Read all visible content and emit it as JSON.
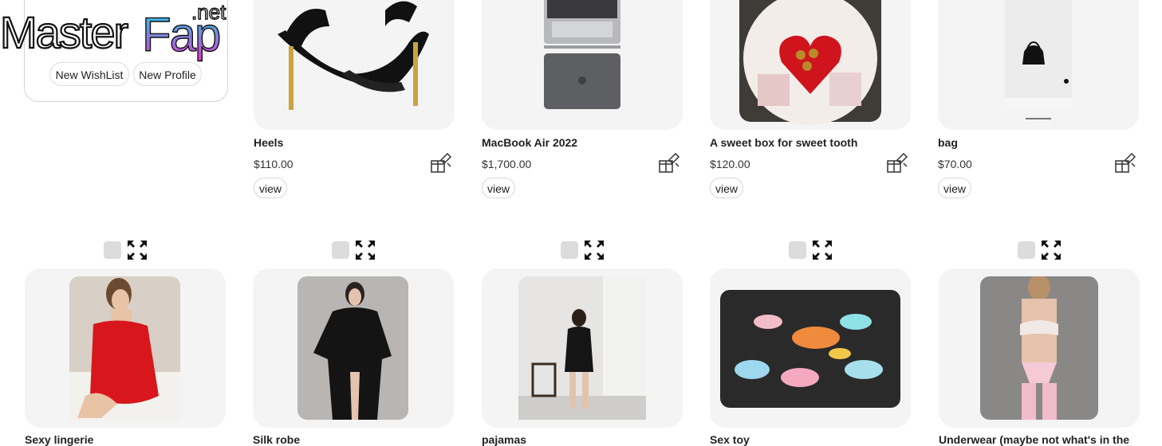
{
  "site": {
    "brand_main": "MasterFap",
    "brand_suffix": ".net"
  },
  "sidebar": {
    "new_wishlist_label": "New WishList",
    "new_profile_label": "New Profile"
  },
  "top_products": [
    {
      "name": "Heels",
      "price": "$110.00",
      "view_label": "view"
    },
    {
      "name": "MacBook Air 2022",
      "price": "$1,700.00",
      "view_label": "view"
    },
    {
      "name": "A sweet box for sweet tooth",
      "price": "$120.00",
      "view_label": "view"
    },
    {
      "name": "bag",
      "price": "$70.00",
      "view_label": "view"
    }
  ],
  "bottom_products": [
    {
      "name": "Sexy lingerie"
    },
    {
      "name": "Silk robe"
    },
    {
      "name": "pajamas"
    },
    {
      "name": "Sex toy"
    },
    {
      "name": "Underwear (maybe not what's in the"
    }
  ],
  "icons": {
    "gift": "gift-ribbon-icon",
    "select": "checkbox-icon",
    "expand": "expand-arrows-icon"
  },
  "colors": {
    "card_bg": "#f4f4f4",
    "watermark_cyan": "#19c7e6",
    "watermark_magenta": "#e23bd6"
  }
}
